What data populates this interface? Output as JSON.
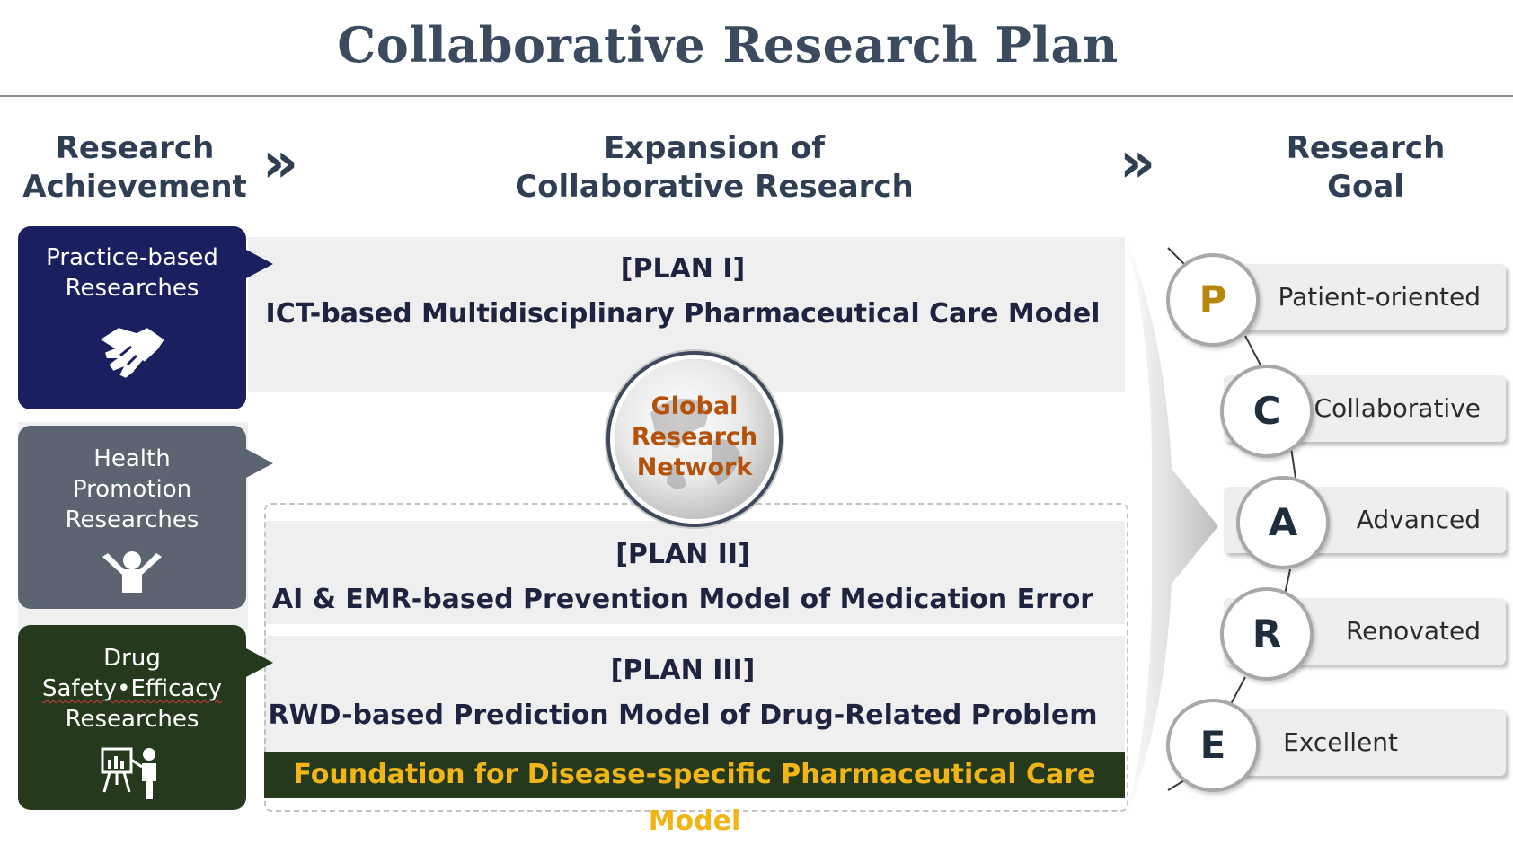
{
  "title": "Collaborative Research Plan",
  "headers": {
    "left": "Research\nAchievement",
    "middle": "Expansion of\nCollaborative Research",
    "right": "Research\nGoal",
    "arrow": "»"
  },
  "achievements": [
    {
      "text": "Practice-based\nResearches",
      "color": "#1a1f60",
      "icon": "handshake-icon"
    },
    {
      "text": "Health\nPromotion\nResearches",
      "color": "#5b6470",
      "icon": "person-cheering-icon"
    },
    {
      "line1": "Drug",
      "line2": "Safety•Efficacy",
      "line3": "Researches",
      "color": "#253a1c",
      "icon": "presenter-chart-icon"
    }
  ],
  "plans": [
    {
      "tag": "[PLAN I]",
      "title": "ICT-based Multidisciplinary Pharmaceutical Care Model"
    },
    {
      "tag": "[PLAN II]",
      "title": "AI & EMR-based Prevention Model of Medication Error"
    },
    {
      "tag": "[PLAN III]",
      "title": "RWD-based Prediction Model of Drug-Related Problem"
    }
  ],
  "foundation": "Foundation for Disease-specific Pharmaceutical Care Model",
  "globe": "Global\nResearch\nNetwork",
  "goals": [
    {
      "letter": "P",
      "label": "Patient-oriented",
      "letter_color": "#b8860b"
    },
    {
      "letter": "C",
      "label": "Collaborative",
      "letter_color": "#1f2d3d"
    },
    {
      "letter": "A",
      "label": "Advanced",
      "letter_color": "#1f2d3d"
    },
    {
      "letter": "R",
      "label": "Renovated",
      "letter_color": "#1f2d3d"
    },
    {
      "letter": "E",
      "label": "Excellent",
      "letter_color": "#1f2d3d"
    }
  ],
  "colors": {
    "navy": "#1a1f60",
    "slate": "#5b6470",
    "forest": "#253a1c",
    "gold": "#f2b516",
    "globe_text": "#b4520b"
  }
}
